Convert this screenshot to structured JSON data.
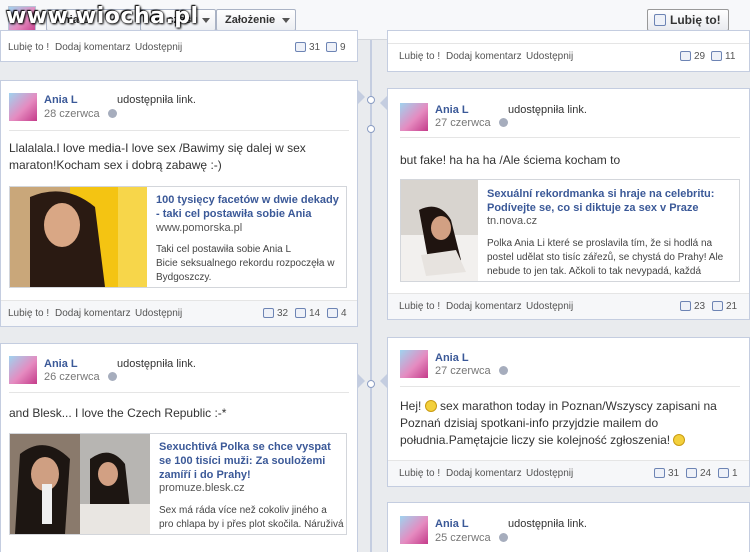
{
  "watermark": "www.wiocha.pl",
  "topbar": {
    "selector1": "Ania L",
    "selector2": "Od czasu",
    "selector3": "Założenie",
    "like_button": "Lubię to!"
  },
  "actions": {
    "like": "Lubię to !",
    "comment": "Dodaj komentarz",
    "share": "Udostępnij"
  },
  "posts": [
    {
      "stats": {
        "likes": "31",
        "comments": "9"
      }
    },
    {
      "stats": {
        "likes": "29",
        "comments": "11"
      }
    },
    {
      "author": "Ania L",
      "action": "udostępniła link.",
      "date": "28 czerwca",
      "text": "Llalalala.I love media-I love sex /Bawimy się dalej w sex maraton!Kocham sex i dobrą zabawę :-)",
      "link": {
        "title": "100 tysięcy facetów w dwie dekady - taki cel postawiła sobie Ania",
        "domain": "www.pomorska.pl",
        "desc_line1": "Taki cel postawiła sobie Ania L",
        "desc_line2": "Bicie seksualnego rekordu rozpoczęła w Bydgoszczy."
      },
      "stats": {
        "likes": "32",
        "comments": "14",
        "shares": "4"
      }
    },
    {
      "author": "Ania L",
      "action": "udostępniła link.",
      "date": "27 czerwca",
      "text": "but fake! ha ha ha /Ale ściema kocham to",
      "link": {
        "title": "Sexuální rekordmanka si hraje na celebritu: Podívejte se, co si diktuje za sex v Praze",
        "domain": "tn.nova.cz",
        "desc": "Polka Ania Li které se proslavila tím, že si hodlá na postel udělat sto tisíc zářezů, se chystá do Prahy! Ale nebude to jen tak. Ačkoli to tak nevypadá, každá"
      },
      "stats": {
        "likes": "23",
        "comments": "21"
      }
    },
    {
      "author": "Ania L",
      "action": "udostępniła link.",
      "date": "26 czerwca",
      "text": "and Blesk... I love the Czech Republic :-*",
      "link": {
        "title": "Sexuchtivá Polka se chce vyspat se 100 tisíci muži: Za souložemi zamíří i do Prahy!",
        "domain": "promuze.blesk.cz",
        "desc": "Sex má ráda více než cokoliv jiného a pro chlapa by i přes plot skočila. Náruživá"
      }
    },
    {
      "author": "Ania L",
      "date": "27 czerwca",
      "text_part1": "Hej!",
      "text_part2": "sex marathon today in Poznan/Wszyscy zapisani na Poznań dzisiaj spotkani-info przyjdzie mailem do południa.Pamętajcie liczy sie kolejność zgłoszenia!",
      "stats": {
        "likes": "31",
        "comments": "24",
        "shares": "1"
      }
    },
    {
      "author": "Ania L",
      "action": "udostępniła link.",
      "date": "25 czerwca"
    }
  ]
}
